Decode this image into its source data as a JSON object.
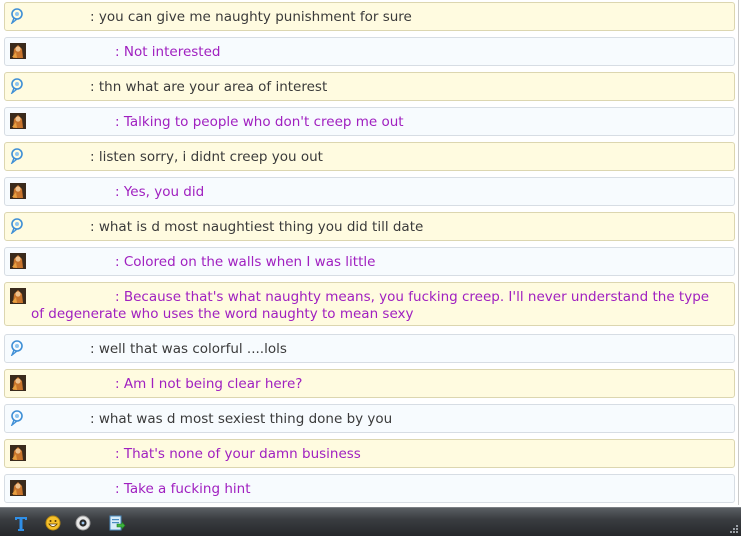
{
  "messages": [
    {
      "sender": "me",
      "text": ": you can give me naughty punishment for sure"
    },
    {
      "sender": "them",
      "text": ": Not interested"
    },
    {
      "sender": "me",
      "text": ": thn what are your area of interest"
    },
    {
      "sender": "them",
      "text": ": Talking to people who don't creep me out"
    },
    {
      "sender": "me",
      "text": ": listen sorry, i didnt creep you out"
    },
    {
      "sender": "them",
      "text": ": Yes, you did"
    },
    {
      "sender": "me",
      "text": ": what is d most naughtiest thing you did till date"
    },
    {
      "sender": "them",
      "text": ": Colored on the walls when I was little"
    },
    {
      "sender": "them",
      "text": ": Because that's what naughty means, you fucking creep. I'll never understand the type of degenerate who uses the word  naughty to mean sexy"
    },
    {
      "sender": "me",
      "text": ": well that was colorful ....lols"
    },
    {
      "sender": "them",
      "text": ": Am I not being clear here?"
    },
    {
      "sender": "me",
      "text": ": what was d most sexiest thing done by you"
    },
    {
      "sender": "them",
      "text": ": That's none of your damn business"
    },
    {
      "sender": "them",
      "text": ": Take a fucking hint"
    }
  ],
  "toolbar": {
    "icons": [
      "text-format-icon",
      "emoticon-icon",
      "webcam-icon",
      "file-transfer-icon"
    ]
  },
  "colors": {
    "me_text": "#3a3a3a",
    "them_text": "#a020c0",
    "bubble_yellow": "#fffbe0",
    "bubble_blue": "#f7fbfe"
  }
}
